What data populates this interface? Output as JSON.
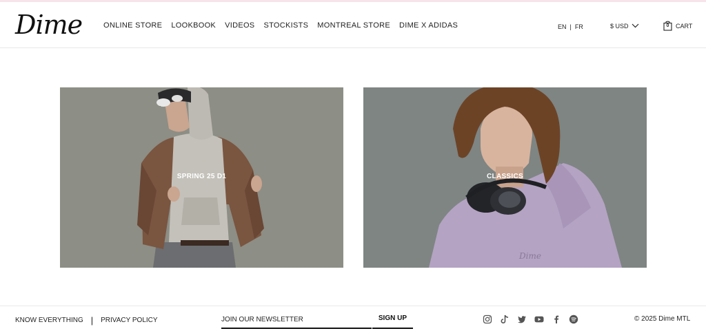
{
  "brand": {
    "logo_text": "Dime"
  },
  "nav": {
    "items": [
      "ONLINE STORE",
      "LOOKBOOK",
      "VIDEOS",
      "STOCKISTS",
      "MONTREAL STORE",
      "DIME X ADIDAS"
    ]
  },
  "header": {
    "lang_en": "EN",
    "lang_sep": "|",
    "lang_fr": "FR",
    "currency": "$ USD",
    "cart_label": "CART",
    "cart_count": "0"
  },
  "tiles": [
    {
      "label": "SPRING 25 D1",
      "background": "#8a8b83"
    },
    {
      "label": "CLASSICS",
      "background": "#7e8583",
      "garment_print": "Dime"
    }
  ],
  "footer": {
    "know_everything": "KNOW EVERYTHING",
    "separator": "|",
    "privacy_policy": "PRIVACY POLICY",
    "newsletter_placeholder": "JOIN OUR NEWSLETTER",
    "signup_label": "SIGN UP",
    "social_icons": [
      "instagram-icon",
      "tiktok-icon",
      "twitter-icon",
      "youtube-icon",
      "facebook-icon",
      "spotify-icon"
    ],
    "copyright": "© 2025 Dime MTL"
  },
  "colors": {
    "accent_line": "#f7e3ea",
    "text": "#222222"
  }
}
